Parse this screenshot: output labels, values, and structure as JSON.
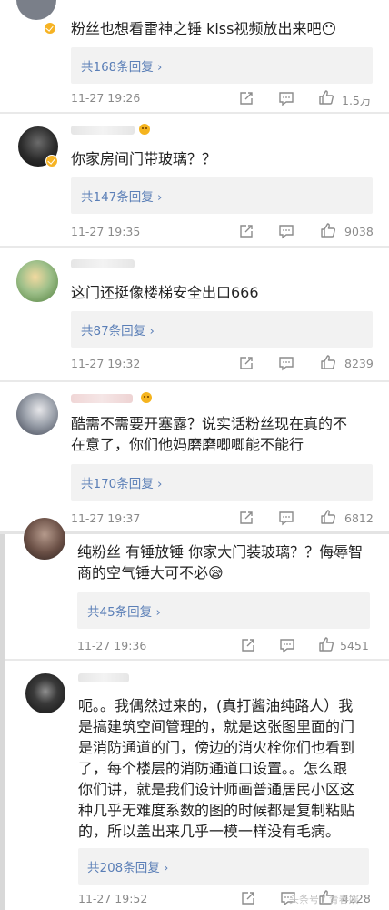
{
  "comments": [
    {
      "text_lines": [
        "粉丝也想看雷神之锤 kiss视频放出来吧😶"
      ],
      "replies": "共168条回复 ›",
      "time": "11-27 19:26",
      "likes": "1.5万"
    },
    {
      "text_lines": [
        "你家房间门带玻璃？？"
      ],
      "replies": "共147条回复 ›",
      "time": "11-27 19:35",
      "likes": "9038"
    },
    {
      "text_lines": [
        "这门还挺像楼梯安全出口666"
      ],
      "replies": "共87条回复 ›",
      "time": "11-27 19:32",
      "likes": "8239"
    },
    {
      "text_lines": [
        "酷需不需要开塞露？说实话粉丝现在真的不",
        "在意了，你们他妈磨磨唧唧能不能行"
      ],
      "replies": "共170条回复 ›",
      "time": "11-27 19:37",
      "likes": "6812"
    },
    {
      "text_lines": [
        "纯粉丝 有锤放锤 你家大门装玻璃？？侮辱智",
        "商的空气锤大可不必😪"
      ],
      "replies": "共45条回复 ›",
      "time": "11-27 19:36",
      "likes": "5451"
    },
    {
      "text_lines": [
        "呃。。我偶然过来的，(真打酱油纯路人）我",
        "是搞建筑空间管理的，就是这张图里面的门",
        "是消防通道的门，傍边的消火栓你们也看到",
        "了，每个楼层的消防通道口设置。。怎么跟",
        "你们讲，就是我们设计师画普通居民小区这",
        "种几乎无难度系数的图的时候都是复制粘贴",
        "的，所以盖出来几乎一模一样没有毛病。"
      ],
      "replies": "共208条回复 ›",
      "time": "11-27 19:52",
      "likes": "4228"
    }
  ],
  "watermark": "头条号 / 青春娱",
  "icons": {
    "forward": "share-icon",
    "comment": "comment-icon",
    "like": "thumbs-up-icon",
    "verified": "verified-badge-icon"
  },
  "colors": {
    "link": "#5b7fb7",
    "meta": "#8a8a8a",
    "reply_bg": "#f2f2f2",
    "verified": "#f6b324"
  }
}
